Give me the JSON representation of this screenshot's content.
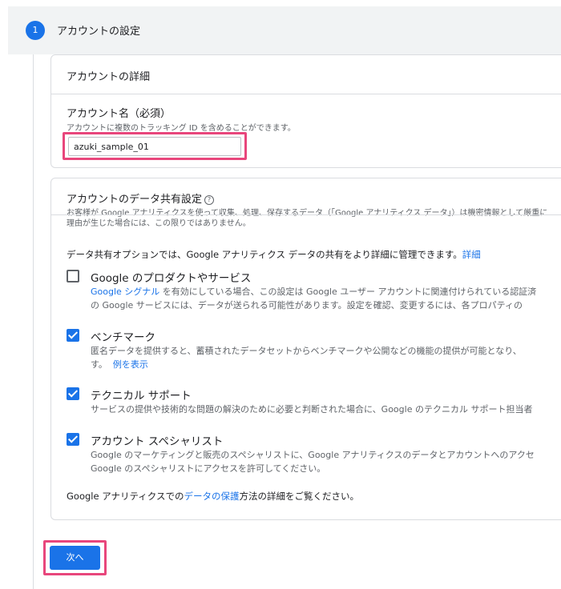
{
  "step": {
    "number": "1",
    "title": "アカウントの設定"
  },
  "account_details": {
    "header": "アカウントの詳細",
    "name_label": "アカウント名（必須）",
    "name_hint": "アカウントに複数のトラッキング ID を含めることができます。",
    "name_value": "azuki_sample_01"
  },
  "data_sharing": {
    "header": "アカウントのデータ共有設定",
    "help_icon": "?",
    "desc_line1": "お客様が Google アナリティクスを使って収集、処理、保存するデータ（「Google アナリティクス データ」）は機密情報として厳重に",
    "desc_line2": "理由が生じた場合には、この限りではありません。",
    "intro_text": "データ共有オプションでは、Google アナリティクス データの共有をより詳細に管理できます。",
    "intro_link": "詳細",
    "options": [
      {
        "title": "Google のプロダクトやサービス",
        "checked": false,
        "desc_link": "Google シグナル",
        "desc_line1_rest": " を有効にしている場合、この設定は Google ユーザー アカウントに関連付けられている認証済",
        "desc_line2": "の Google サービスには、データが送られる可能性があります。設定を確認、変更するには、各プロパティの"
      },
      {
        "title": "ベンチマーク",
        "checked": true,
        "desc_line1": "匿名データを提供すると、蓄積されたデータセットからベンチマークや公開などの機能の提供が可能となり、",
        "desc_line2": "す。",
        "desc_link": "例を表示"
      },
      {
        "title": "テクニカル サポート",
        "checked": true,
        "desc_line1": "サービスの提供や技術的な問題の解決のために必要と判断された場合に、Google のテクニカル サポート担当者"
      },
      {
        "title": "アカウント スペシャリスト",
        "checked": true,
        "desc_line1": "Google のマーケティングと販売のスペシャリストに、Google アナリティクスのデータとアカウントへのアクセ",
        "desc_line2": "Google のスペシャリストにアクセスを許可してください。"
      }
    ],
    "footer_prefix": "Google アナリティクスでの",
    "footer_link": "データの保護",
    "footer_suffix": "方法の詳細をご覧ください。"
  },
  "next_button": {
    "label": "次へ"
  },
  "colors": {
    "primary": "#1a73e8",
    "highlight": "#e8467c"
  }
}
